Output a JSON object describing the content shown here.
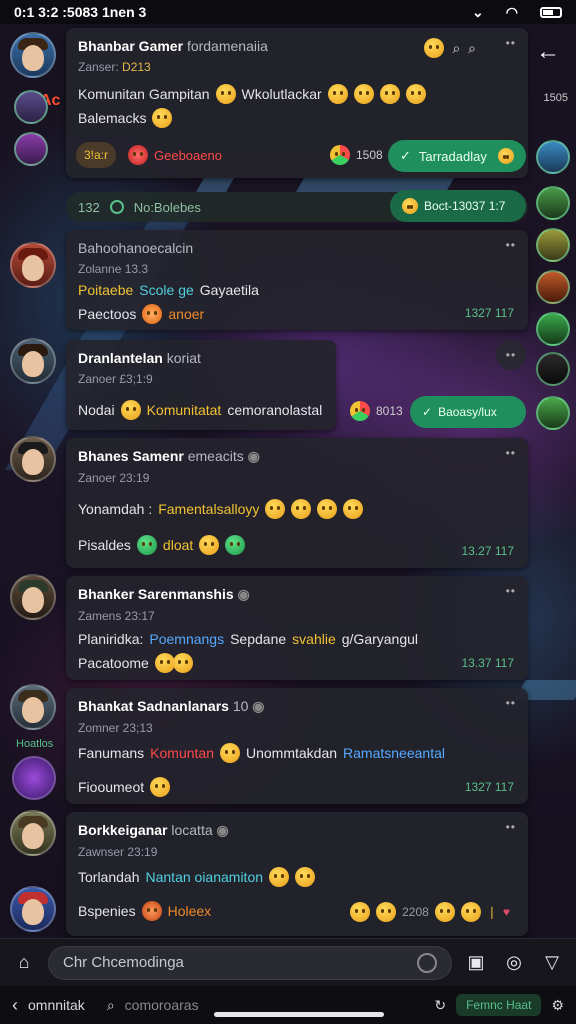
{
  "status_bar": {
    "time": "0:1 3:2 :5083 1nen 3",
    "icons": [
      "chevron-down-icon",
      "wifi-icon",
      "battery-icon"
    ]
  },
  "messages": [
    {
      "name": "Bhanbar Gamer",
      "name_suffix": "fordamenaiia",
      "time_label": "Zanser:",
      "time_value": "D213",
      "text": "Komunitan Gampitan",
      "text_tail": "Wkolutlackar",
      "subline": "Balemacks",
      "chip_left": "3!a:r",
      "chip_mid": "Geeboaeno",
      "chip_ts": "1508",
      "action_label": "Tarradadlay"
    },
    {
      "id_badge": "132",
      "system_label": "No:Bolebes",
      "system_ts": "Boct-13037 1:7"
    },
    {
      "name": "Bahoohanoecalcin",
      "time_label": "Zolanne 13.3",
      "line1_a": "Poitaebe",
      "line1_b": "Scole ge",
      "line1_c": "Gayaetila",
      "line2": "Paectoos",
      "line2_tail": "anoer",
      "ts": "1327 117"
    },
    {
      "name": "Dranlantelan",
      "name_suffix": "koriat",
      "time_label": "Zanoer £3;1:9",
      "text_label": "Nodai",
      "text": "Komunitatat",
      "text_tail": "cemoranolastal",
      "chip_ts": "8013",
      "action_label": "Baoasy/lux"
    },
    {
      "name": "Bhanes Samenr",
      "name_suffix": "emeacits",
      "time_label": "Zanoer 23:19",
      "text_label": "Yonamdah :",
      "text": "Famentalsalloyy",
      "line2": "Pisaldes",
      "line2_tail": "dloat",
      "ts": "13.27 117"
    },
    {
      "name": "Bhanker Sarenmanshis",
      "time_label": "Zamens 23:17",
      "text_label": "Planiridka:",
      "text_a": "Poemnangs",
      "text_b": "Sepdane",
      "text_c": "svahlie",
      "text_d": "g/Garyangul",
      "line2": "Pacatoome",
      "ts": "13.37 117"
    },
    {
      "name": "Bhankat Sadnanlanars",
      "name_suffix": "10",
      "time_label": "Zomner 23;13",
      "text_label": "Fanumans",
      "text_a": "Komuntan",
      "text_b": "Unommtakdan",
      "text_c": "Ramatsneeantal",
      "line2": "Fiooumeot",
      "side_label": "Hoatlos",
      "ts": "1327 117"
    },
    {
      "name": "Borkkeiganar",
      "name_suffix": "locatta",
      "time_label": "Zawnser 23:19",
      "text_label": "Torlandah",
      "text": "Nantan oianamiton",
      "line2": "Bspenies",
      "line2_tail": "Holeex",
      "ts": "2208"
    }
  ],
  "right_top": {
    "badge": "1505"
  },
  "left_top": {
    "label": "Ac"
  },
  "composer": {
    "placeholder": "Chr Chcemodinga"
  },
  "nav_bar": {
    "back_label": "omnnitak",
    "search_label": "comoroaras",
    "action_label": "Femnc Haat"
  }
}
